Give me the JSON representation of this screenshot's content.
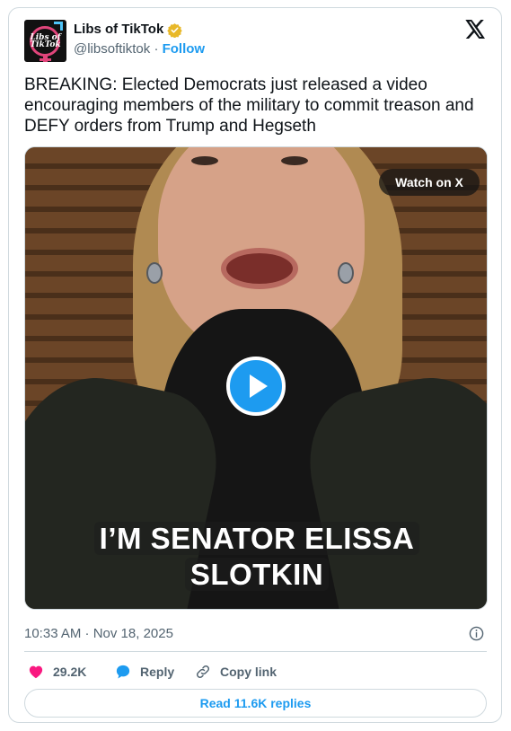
{
  "author": {
    "name": "Libs of TikTok",
    "handle": "@libsoftiktok",
    "separator": "·",
    "follow_label": "Follow",
    "avatar_text": "Libs of TikTok",
    "verified_color": "#e8b829"
  },
  "tweet": {
    "text": "BREAKING: Elected Democrats just released a video encouraging members of the military to commit treason and DEFY orders from Trump and Hegseth"
  },
  "media": {
    "watch_label": "Watch on X",
    "caption_line1": "I’M SENATOR ELISSA",
    "caption_line2": "SLOTKIN",
    "play_icon": "play-icon"
  },
  "meta": {
    "timestamp": "10:33 AM · Nov 18, 2025"
  },
  "actions": {
    "like_count": "29.2K",
    "reply_label": "Reply",
    "copy_label": "Copy link"
  },
  "footer": {
    "read_replies_label": "Read 11.6K replies"
  },
  "colors": {
    "accent": "#1d9bf0",
    "like": "#f91880",
    "text": "#0f1419",
    "muted": "#536471",
    "border": "#cfd9de"
  }
}
